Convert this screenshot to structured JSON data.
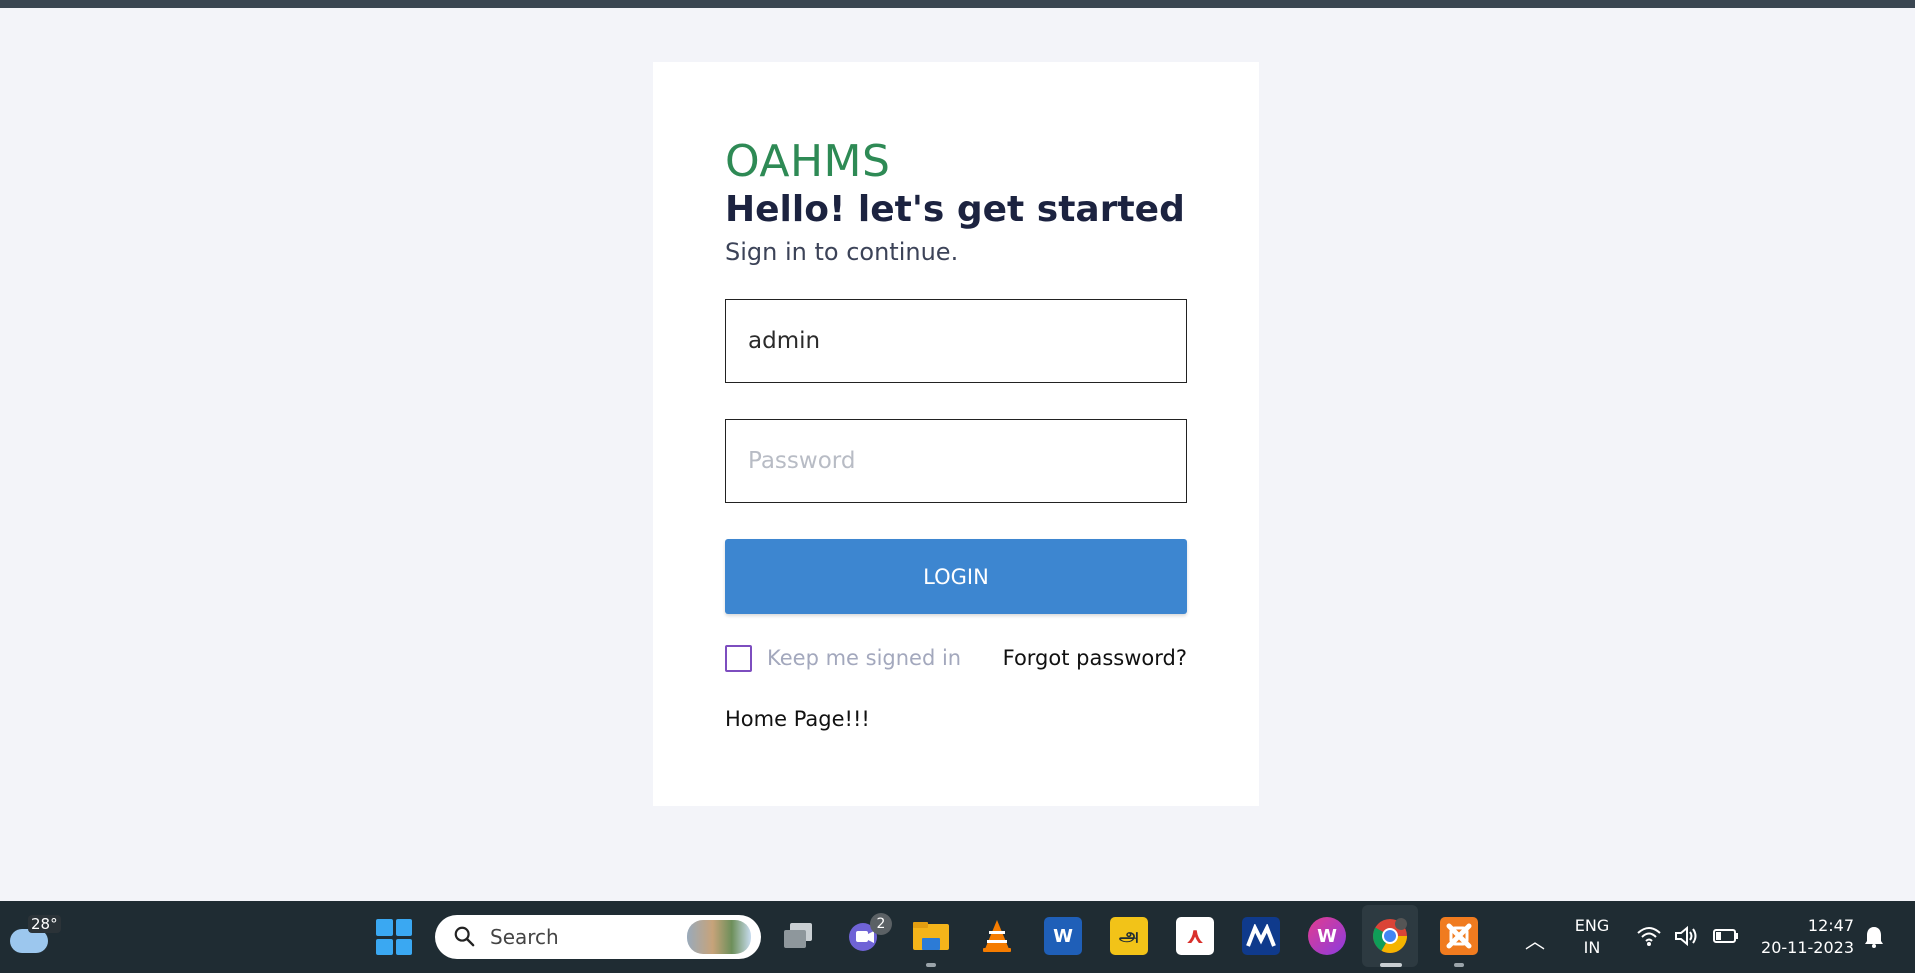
{
  "card": {
    "brand": "OAHMS",
    "headline": "Hello! let's get started",
    "subtitle": "Sign in to continue.",
    "username_value": "admin",
    "password_placeholder": "Password",
    "login_label": "LOGIN",
    "remember_label": "Keep me signed in",
    "remember_checked": false,
    "forgot_label": "Forgot password?",
    "home_link": "Home Page!!!"
  },
  "taskbar": {
    "weather_temp": "28°",
    "search_placeholder": "Search",
    "teams_badge": "2",
    "apps": [
      "start-icon",
      "task-view-icon",
      "teams-icon",
      "file-explorer-icon",
      "vlc-icon",
      "word-icon",
      "tamil-font-icon",
      "pdf-reader-icon",
      "meraki-icon",
      "wps-office-icon",
      "chrome-icon",
      "xampp-icon"
    ],
    "lang_top": "ENG",
    "lang_bottom": "IN",
    "time": "12:47",
    "date": "20-11-2023"
  },
  "colors": {
    "brand": "#2e8a55",
    "login_button": "#3d86d0",
    "checkbox_border": "#7d4dbf",
    "taskbar": "#1f2c33"
  }
}
